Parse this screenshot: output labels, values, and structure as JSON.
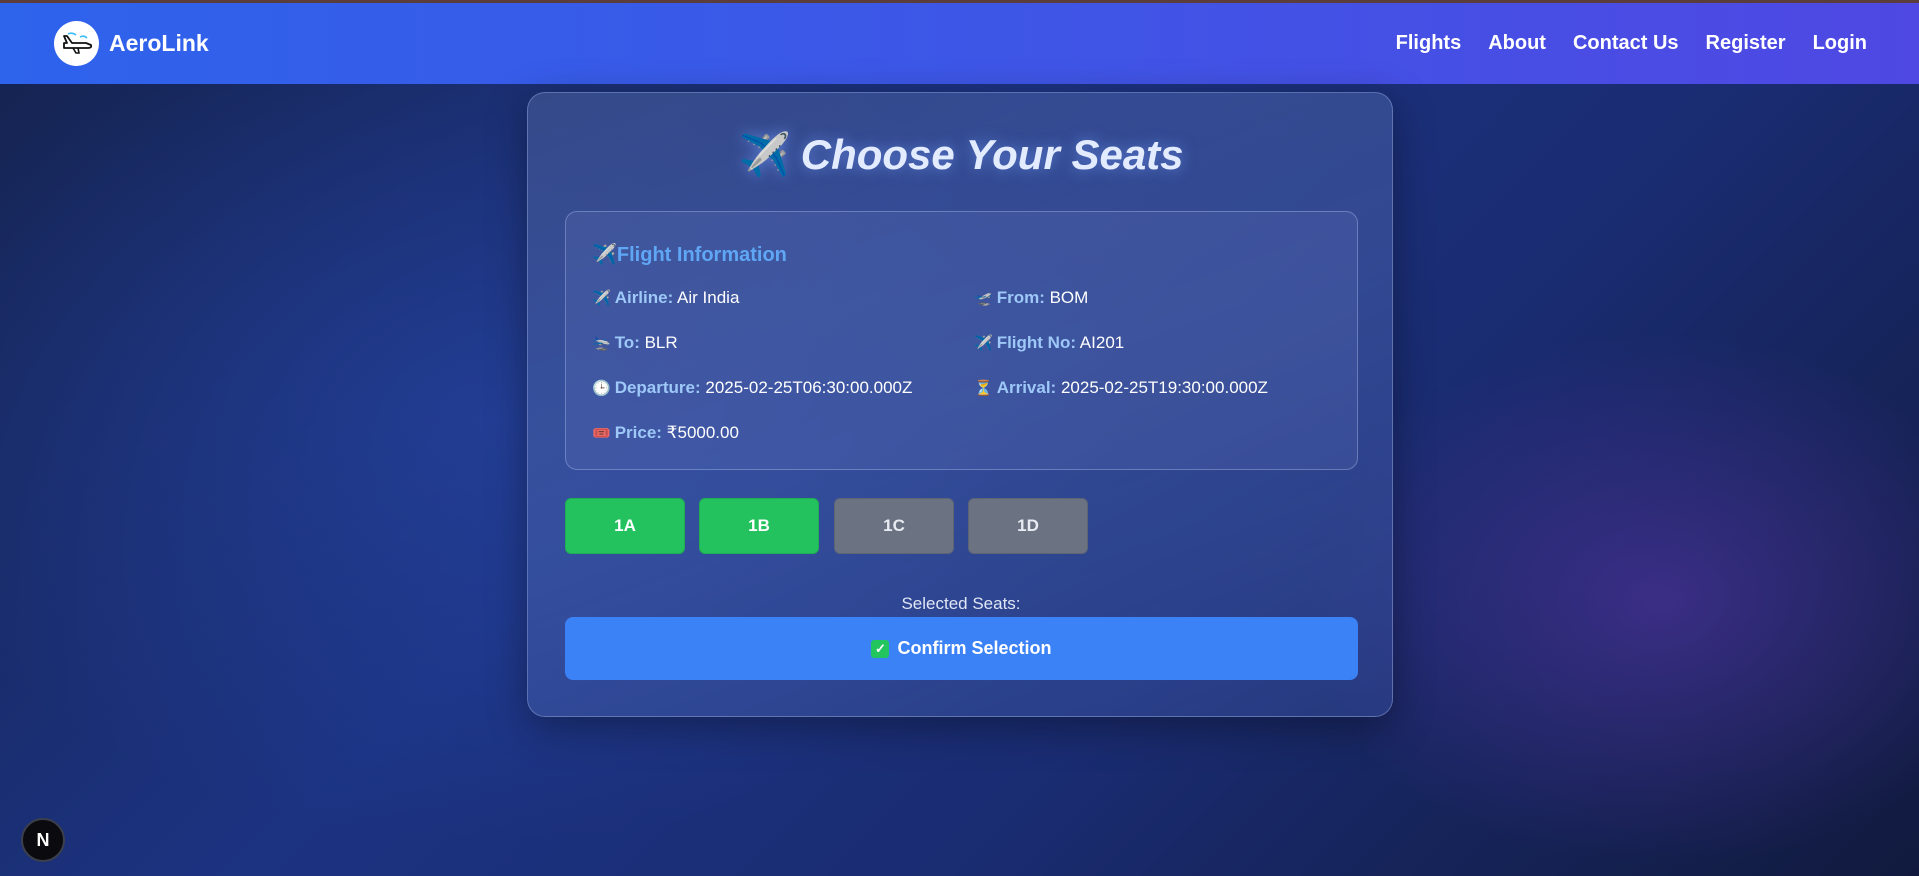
{
  "navbar": {
    "brand": "AeroLink",
    "links": [
      "Flights",
      "About",
      "Contact Us",
      "Register",
      "Login"
    ]
  },
  "page": {
    "title": "Choose Your Seats",
    "title_icon": "✈️"
  },
  "flight_info": {
    "title": "Flight Information",
    "title_icon": "✈️",
    "airline": {
      "icon": "✈️",
      "label": "Airline:",
      "value": "Air India"
    },
    "from": {
      "icon": "🛫",
      "label": "From:",
      "value": "BOM"
    },
    "to": {
      "icon": "🛬",
      "label": "To:",
      "value": "BLR"
    },
    "flight_no": {
      "icon": "✈️",
      "label": "Flight No:",
      "value": "AI201"
    },
    "departure": {
      "icon": "🕒",
      "label": "Departure:",
      "value": "2025-02-25T06:30:00.000Z"
    },
    "arrival": {
      "icon": "⏳",
      "label": "Arrival:",
      "value": "2025-02-25T19:30:00.000Z"
    },
    "price": {
      "icon": "🎟️",
      "label": "Price:",
      "value": "₹5000.00"
    }
  },
  "seats": [
    {
      "id": "1A",
      "status": "available",
      "color": "#23c25e"
    },
    {
      "id": "1B",
      "status": "available",
      "color": "#23c25e"
    },
    {
      "id": "1C",
      "status": "booked",
      "color": "#6b7383"
    },
    {
      "id": "1D",
      "status": "booked",
      "color": "#6b7383"
    }
  ],
  "selection": {
    "label": "Selected Seats:",
    "confirm_label": "Confirm Selection",
    "confirm_icon": "✓"
  },
  "dev_badge": {
    "letter": "N"
  },
  "colors": {
    "navbar_start": "#2e63ec",
    "navbar_end": "#4f48e3",
    "available_seat": "#23c25e",
    "booked_seat": "#6b7383",
    "confirm_button": "#3b82f6",
    "info_title": "#5fa7f5"
  }
}
